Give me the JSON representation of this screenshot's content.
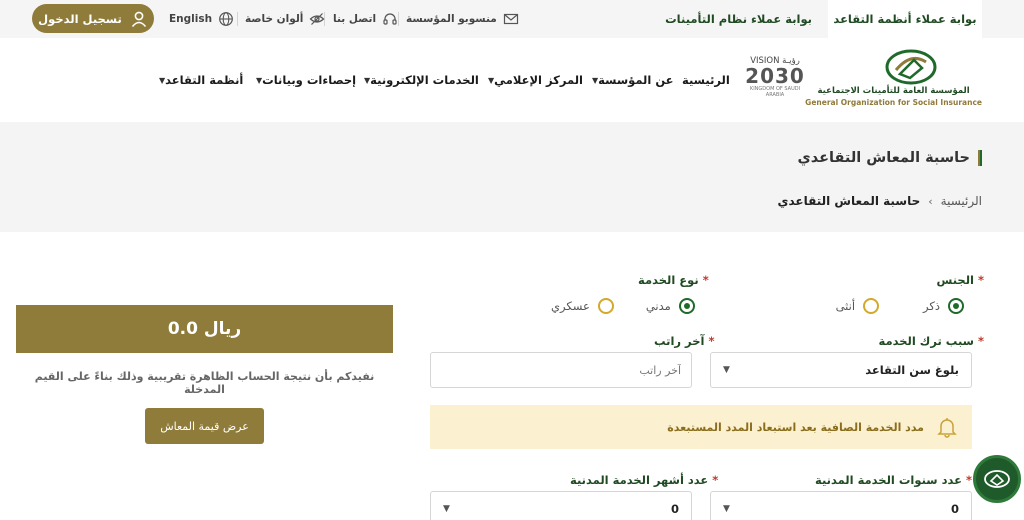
{
  "topbar": {
    "portal_retirement": "بوابة عملاء أنظمة التقاعد",
    "portal_insurance": "بوابة عملاء نظام التأمينات",
    "employees": "منسوبو المؤسسة",
    "contact": "اتصل بنا",
    "special_colors": "ألوان خاصة",
    "language": "English",
    "login": "تسجيل الدخول"
  },
  "logo": {
    "name_ar": "المؤسسة العامة للتأمينات الاجتماعية",
    "name_en": "General Organization for Social Insurance",
    "vision_top": "VISION رؤيـة",
    "vision_year": "2030",
    "vision_sub": "KINGDOM OF SAUDI ARABIA"
  },
  "nav": {
    "home": "الرئيسية",
    "about": "عن المؤسسة",
    "media": "المركز الإعلامي",
    "eservices": "الخدمات الإلكترونية",
    "stats": "إحصاءات وبيانات",
    "retirement": "أنظمة التقاعد"
  },
  "page": {
    "title": "حاسبة المعاش التقاعدي",
    "crumb_home": "الرئيسية",
    "crumb_current": "حاسبة المعاش التقاعدي"
  },
  "form": {
    "gender_label": "الجنس",
    "gender_male": "ذكر",
    "gender_female": "أنثى",
    "service_type_label": "نوع الخدمة",
    "service_civil": "مدني",
    "service_military": "عسكري",
    "leave_reason_label": "سبب ترك الخدمة",
    "leave_reason_value": "بلوغ سن التقاعد",
    "last_salary_label": "آخر راتب",
    "last_salary_placeholder": "آخر راتب",
    "notice": "مدد الخدمة الصافية بعد استبعاد المدد المستبعدة",
    "civil_years_label": "عدد سنوات الخدمة المدنية",
    "civil_years_value": "0",
    "civil_months_label": "عدد أشهر الخدمة المدنية",
    "civil_months_value": "0"
  },
  "result": {
    "amount": "0.0 ريال",
    "note": "نفيدكم بأن نتيجة الحساب الظاهرة تقريبية وذلك بناءً على القيم المدخلة",
    "button": "عرض قيمة المعاش"
  }
}
